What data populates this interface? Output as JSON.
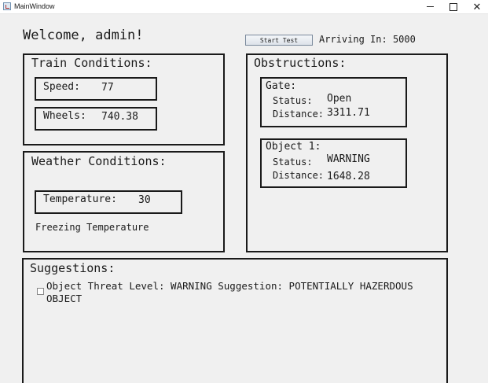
{
  "window": {
    "title": "MainWindow"
  },
  "header": {
    "welcome": "Welcome, admin!",
    "start_test_label": "Start Test",
    "arriving_label": "Arriving In:",
    "arriving_value": "5000"
  },
  "train": {
    "title": "Train Conditions:",
    "speed_label": "Speed:",
    "speed_value": "77",
    "wheels_label": "Wheels:",
    "wheels_value": "740.38"
  },
  "weather": {
    "title": "Weather Conditions:",
    "temperature_label": "Temperature:",
    "temperature_value": "30",
    "status_text": "Freezing Temperature"
  },
  "obstructions": {
    "title": "Obstructions:",
    "gate": {
      "title": "Gate:",
      "status_label": "Status:",
      "status_value": "Open",
      "distance_label": "Distance:",
      "distance_value": "3311.71"
    },
    "object1": {
      "title": "Object 1:",
      "status_label": "Status:",
      "status_value": "WARNING",
      "distance_label": "Distance:",
      "distance_value": "1648.28"
    }
  },
  "suggestions": {
    "title": "Suggestions:",
    "items": [
      {
        "text": "Object Threat Level: WARNING Suggestion: POTENTIALLY HAZERDOUS OBJECT",
        "checked": false
      }
    ]
  }
}
